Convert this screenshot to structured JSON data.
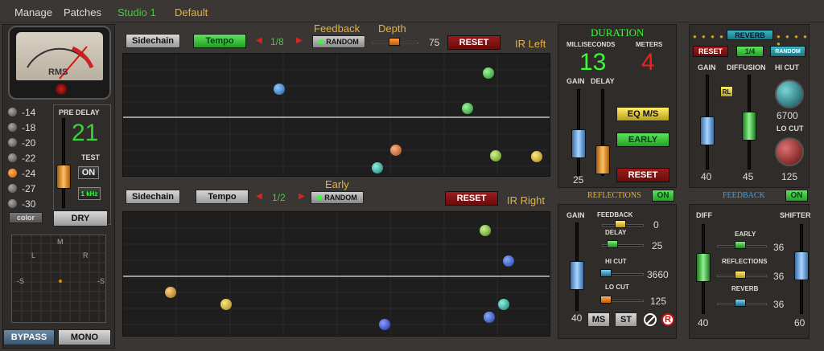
{
  "menu": {
    "manage": "Manage",
    "patches": "Patches",
    "studio": "Studio 1",
    "preset": "Default"
  },
  "meter": {
    "label": "RMS",
    "scale": [
      "-20",
      "-10",
      "-7",
      "-5",
      "-3",
      "-2",
      "-1",
      "0",
      "+1",
      "+2",
      "+3"
    ]
  },
  "levels": [
    {
      "label": "-14",
      "on": false
    },
    {
      "label": "-18",
      "on": false
    },
    {
      "label": "-20",
      "on": false
    },
    {
      "label": "-22",
      "on": false
    },
    {
      "label": "-24",
      "on": true
    },
    {
      "label": "-27",
      "on": false
    },
    {
      "label": "-30",
      "on": false
    }
  ],
  "color_btn": "color",
  "predelay": {
    "title": "PRE DELAY",
    "value": "21",
    "test": "TEST",
    "on": "ON",
    "khz": "1 kHz",
    "dry": "DRY"
  },
  "xy": {
    "m": "M",
    "l": "L",
    "r": "R",
    "s1": "-S",
    "s2": "-S"
  },
  "bottom": {
    "bypass": "BYPASS",
    "mono": "MONO"
  },
  "left_grid": {
    "sidechain": "Sidechain",
    "tempo": "Tempo",
    "division": "1/8",
    "random": "RANDOM",
    "feedback": "Feedback",
    "depth": "Depth",
    "depth_value": "75",
    "reset": "RESET",
    "ir": "IR Left"
  },
  "right_grid": {
    "sidechain": "Sidechain",
    "tempo": "Tempo",
    "division": "1/2",
    "random": "RANDOM",
    "early": "Early",
    "reset": "RESET",
    "ir": "IR Right"
  },
  "duration": {
    "title": "DURATION",
    "ms_label": "MILLISECONDS",
    "meters_label": "METERS",
    "ms_value": "13",
    "meters_value": "4",
    "gain": "GAIN",
    "delay": "DELAY",
    "gain_value": "25",
    "eq": "EQ M/S",
    "early": "EARLY",
    "reset": "RESET"
  },
  "reflections": {
    "title": "REFLECTIONS",
    "on": "ON",
    "gain": "GAIN",
    "feedback": "FEEDBACK",
    "feedback_value": "0",
    "delay": "DELAY",
    "delay_value": "25",
    "hicut": "HI CUT",
    "hicut_value": "3660",
    "locut": "LO CUT",
    "locut_value": "125",
    "gain_value": "40",
    "ms": "MS",
    "st": "ST",
    "r": "R"
  },
  "reverb": {
    "reverb_btn": "REVERB",
    "reset": "RESET",
    "division": "1/4",
    "random": "RANDOM",
    "gain": "GAIN",
    "diffusion": "DIFFUSION",
    "hicut": "HI CUT",
    "rl": "RL",
    "hicut_value": "6700",
    "locut": "LO CUT",
    "gain_value": "40",
    "diffusion_value": "45",
    "locut_value": "125"
  },
  "feedback_panel": {
    "title": "FEEDBACK",
    "on": "ON",
    "diff": "DIFF",
    "shifter": "SHIFTER",
    "early": "EARLY",
    "early_value": "36",
    "reflections": "REFLECTIONS",
    "reflections_value": "36",
    "reverb": "REVERB",
    "reverb_value": "36",
    "diff_value": "40",
    "shifter_value": "60"
  }
}
